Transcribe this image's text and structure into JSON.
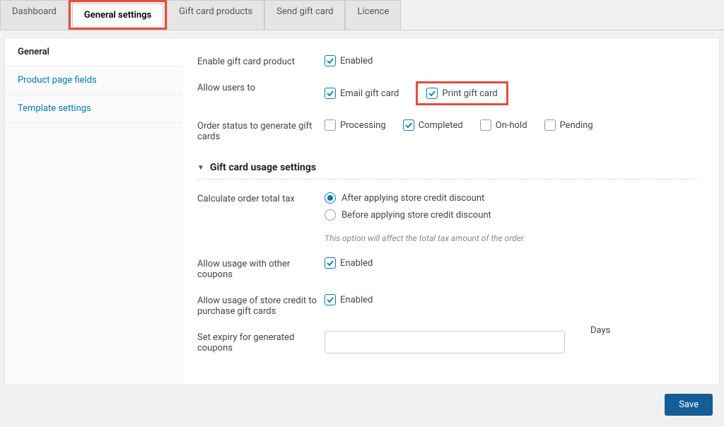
{
  "tabs": [
    {
      "label": "Dashboard"
    },
    {
      "label": "General settings"
    },
    {
      "label": "Gift card products"
    },
    {
      "label": "Send gift card"
    },
    {
      "label": "Licence"
    }
  ],
  "sidebar": [
    {
      "label": "General"
    },
    {
      "label": "Product page fields"
    },
    {
      "label": "Template settings"
    }
  ],
  "general": {
    "enable_product": {
      "label": "Enable gift card product",
      "opt_enabled": "Enabled",
      "enabled": true
    },
    "allow_users": {
      "label": "Allow users to",
      "email": {
        "label": "Email gift card",
        "checked": true
      },
      "print": {
        "label": "Print gift card",
        "checked": true
      }
    },
    "order_status": {
      "label": "Order status to generate gift cards",
      "processing": {
        "label": "Processing",
        "checked": false
      },
      "completed": {
        "label": "Completed",
        "checked": true
      },
      "onhold": {
        "label": "On-hold",
        "checked": false
      },
      "pending": {
        "label": "Pending",
        "checked": false
      }
    }
  },
  "usage": {
    "section_title": "Gift card usage settings",
    "tax": {
      "label": "Calculate order total tax",
      "after": "After applying store credit discount",
      "before": "Before applying store credit discount",
      "helper": "This option will affect the total tax amount of the order"
    },
    "other_coupons": {
      "label": "Allow usage with other coupons",
      "opt_enabled": "Enabled",
      "enabled": true
    },
    "store_credit": {
      "label": "Allow usage of store credit to purchase gift cards",
      "opt_enabled": "Enabled",
      "enabled": true
    },
    "expiry": {
      "label": "Set expiry for generated coupons",
      "value": "",
      "suffix": "Days"
    }
  },
  "save": "Save"
}
